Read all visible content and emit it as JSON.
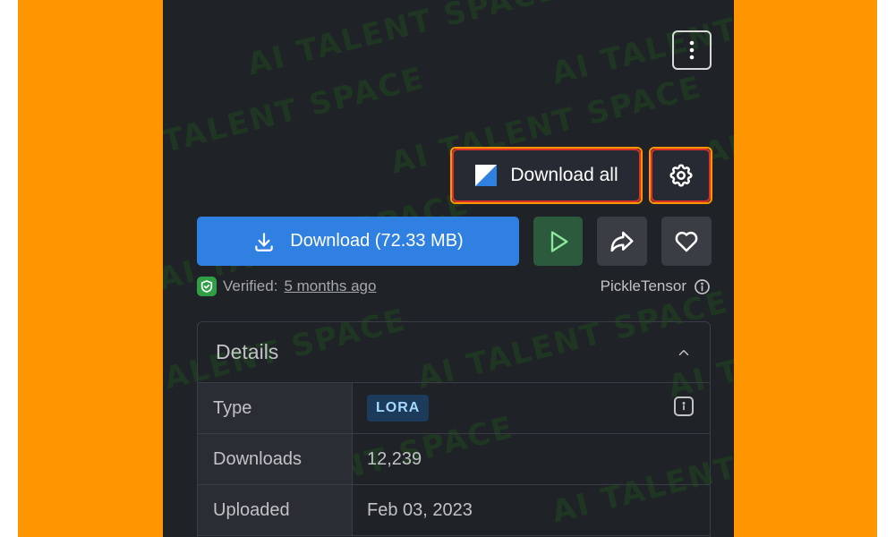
{
  "toolbar": {
    "download_all_label": "Download all"
  },
  "actions": {
    "download_label": "Download (72.33 MB)"
  },
  "verification": {
    "prefix": "Verified:",
    "time_ago": "5 months ago",
    "format": "PickleTensor"
  },
  "details": {
    "title": "Details",
    "rows": [
      {
        "label": "Type",
        "value": "LORA"
      },
      {
        "label": "Downloads",
        "value": "12,239"
      },
      {
        "label": "Uploaded",
        "value": "Feb 03, 2023"
      }
    ]
  },
  "watermark": {
    "text": "AI TALENT SPACE"
  },
  "colors": {
    "background_frame": "#ff9500",
    "panel": "#1f2227",
    "primary": "#2f80e1",
    "highlight_border": "#e0302a",
    "verified": "#2f9e44",
    "badge": "#a5d8ff"
  },
  "icons": {
    "menu": "vertical-dots-icon",
    "download_all": "square-diagonal-icon",
    "settings": "gear-icon",
    "download": "download-icon",
    "play": "play-icon",
    "share": "share-icon",
    "favorite": "heart-icon",
    "verified": "shield-check-icon",
    "info": "info-icon",
    "collapse": "chevron-up-icon"
  }
}
